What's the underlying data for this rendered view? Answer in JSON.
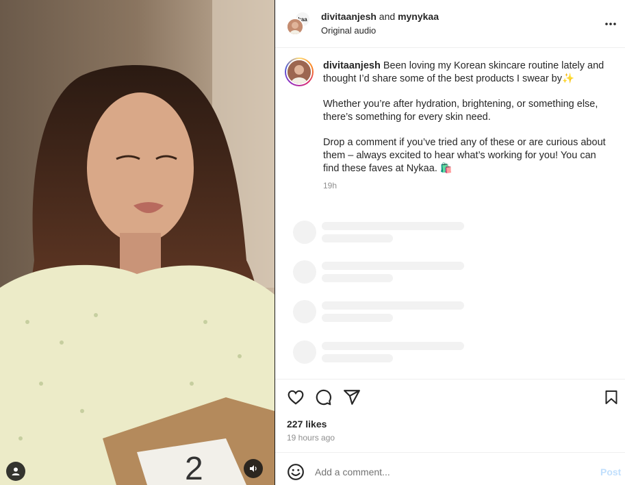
{
  "video": {
    "user_icon": "user-silhouette-icon",
    "audio_icon": "speaker-icon"
  },
  "header": {
    "author": "divitaanjesh",
    "connector": " and ",
    "collaborator": "mynykaa",
    "subtitle": "Original audio",
    "more_icon": "more-horizontal-icon",
    "collab_avatar_text": "kaa"
  },
  "caption": {
    "username": "divitaanjesh",
    "line1": " Been loving my Korean skincare routine lately and thought I’d share some of the best products I swear by✨",
    "line2": "Whether you’re after hydration, brightening, or something else, there’s something for every skin need.",
    "line3": "Drop a comment if you’ve tried any of these or are curious about them – always excited to hear what’s working for you! You can find these faves at Nykaa. 🛍️",
    "time": "19h"
  },
  "actions": {
    "like_icon": "heart-icon",
    "comment_icon": "comment-bubble-icon",
    "share_icon": "paper-plane-icon",
    "save_icon": "bookmark-icon",
    "likes": "227 likes",
    "posted_ago": "19 hours ago"
  },
  "comment_box": {
    "emoji_icon": "smiley-icon",
    "placeholder": "Add a comment...",
    "post_label": "Post"
  },
  "colors": {
    "post_disabled": "#c0dffd",
    "muted_text": "#8e8e8e",
    "skeleton": "#f2f2f2"
  }
}
